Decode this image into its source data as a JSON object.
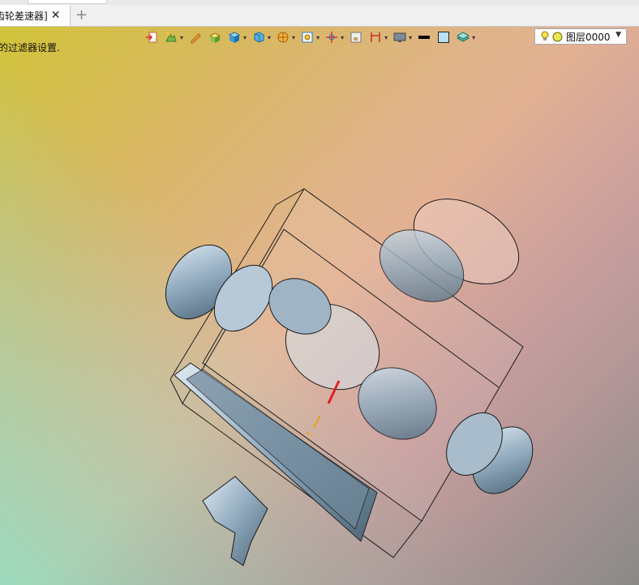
{
  "tab": {
    "label": "齿轮差速器]",
    "close_icon": "close-icon",
    "add_icon": "plus-icon"
  },
  "viewport": {
    "filter_message": "的过滤器设置.",
    "background_colors": [
      "#d2c43a",
      "#e6a4aa",
      "#9cd9bc",
      "#8a8a88"
    ]
  },
  "toolbar": {
    "items": [
      {
        "icon": "exit-sketch-icon",
        "dropdown": false
      },
      {
        "icon": "render-mode-icon",
        "dropdown": true
      },
      {
        "icon": "measure-pen-icon",
        "dropdown": false
      },
      {
        "icon": "shaded-box-icon",
        "dropdown": false
      },
      {
        "icon": "cube-view-icon",
        "dropdown": true
      },
      {
        "icon": "iso-view-icon",
        "dropdown": true
      },
      {
        "icon": "section-view-icon",
        "dropdown": true
      },
      {
        "icon": "zoom-fit-icon",
        "dropdown": true
      },
      {
        "icon": "origin-axes-icon",
        "dropdown": true
      },
      {
        "icon": "datum-plane-icon",
        "dropdown": false
      },
      {
        "icon": "dimension-icon",
        "dropdown": true
      },
      {
        "icon": "display-monitor-icon",
        "dropdown": true
      },
      {
        "icon": "line-color-icon",
        "dropdown": false
      },
      {
        "icon": "face-color-icon",
        "dropdown": false
      },
      {
        "icon": "layer-manager-icon",
        "dropdown": true
      }
    ]
  },
  "layer": {
    "value": "图层0000",
    "icons": [
      "light-bulb-icon",
      "layer-status-icon"
    ]
  }
}
